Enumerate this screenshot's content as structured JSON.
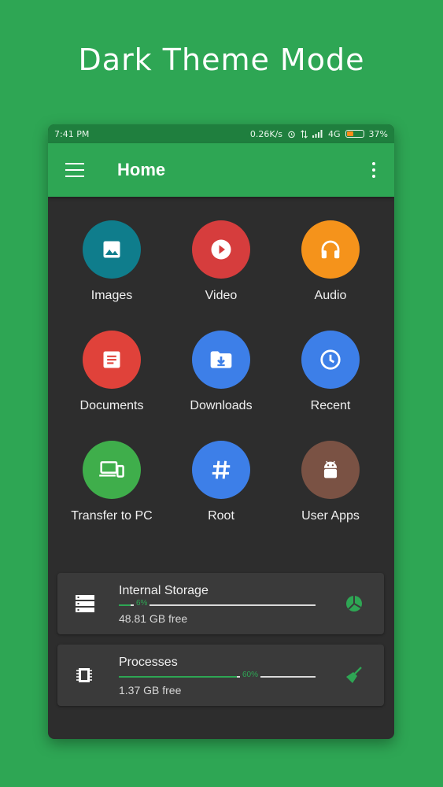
{
  "promo": {
    "title": "Dark Theme Mode"
  },
  "status_bar": {
    "time": "7:41 PM",
    "speed": "0.26K/s",
    "network": "4G",
    "battery": "37%",
    "battery_level": 0.37
  },
  "app_bar": {
    "title": "Home"
  },
  "categories": [
    {
      "label": "Images",
      "color": "#0f7d8c",
      "icon": "image-icon"
    },
    {
      "label": "Video",
      "color": "#d63d3d",
      "icon": "play-icon"
    },
    {
      "label": "Audio",
      "color": "#f5931b",
      "icon": "headphones-icon"
    },
    {
      "label": "Documents",
      "color": "#e0423a",
      "icon": "document-icon"
    },
    {
      "label": "Downloads",
      "color": "#3d7fe8",
      "icon": "download-folder-icon"
    },
    {
      "label": "Recent",
      "color": "#3d7fe8",
      "icon": "clock-icon"
    },
    {
      "label": "Transfer to PC",
      "color": "#3fae4b",
      "icon": "devices-icon"
    },
    {
      "label": "Root",
      "color": "#3d7fe8",
      "icon": "hash-icon"
    },
    {
      "label": "User Apps",
      "color": "#7a5244",
      "icon": "android-icon"
    }
  ],
  "storage": {
    "title": "Internal Storage",
    "percent_label": "6%",
    "percent": 0.06,
    "free": "48.81 GB free"
  },
  "processes": {
    "title": "Processes",
    "percent_label": "60%",
    "percent": 0.6,
    "free": "1.37 GB free"
  },
  "colors": {
    "background": "#2ea654",
    "surface": "#2d2d2d",
    "card": "#3a3a3a",
    "accent": "#2ea654"
  }
}
